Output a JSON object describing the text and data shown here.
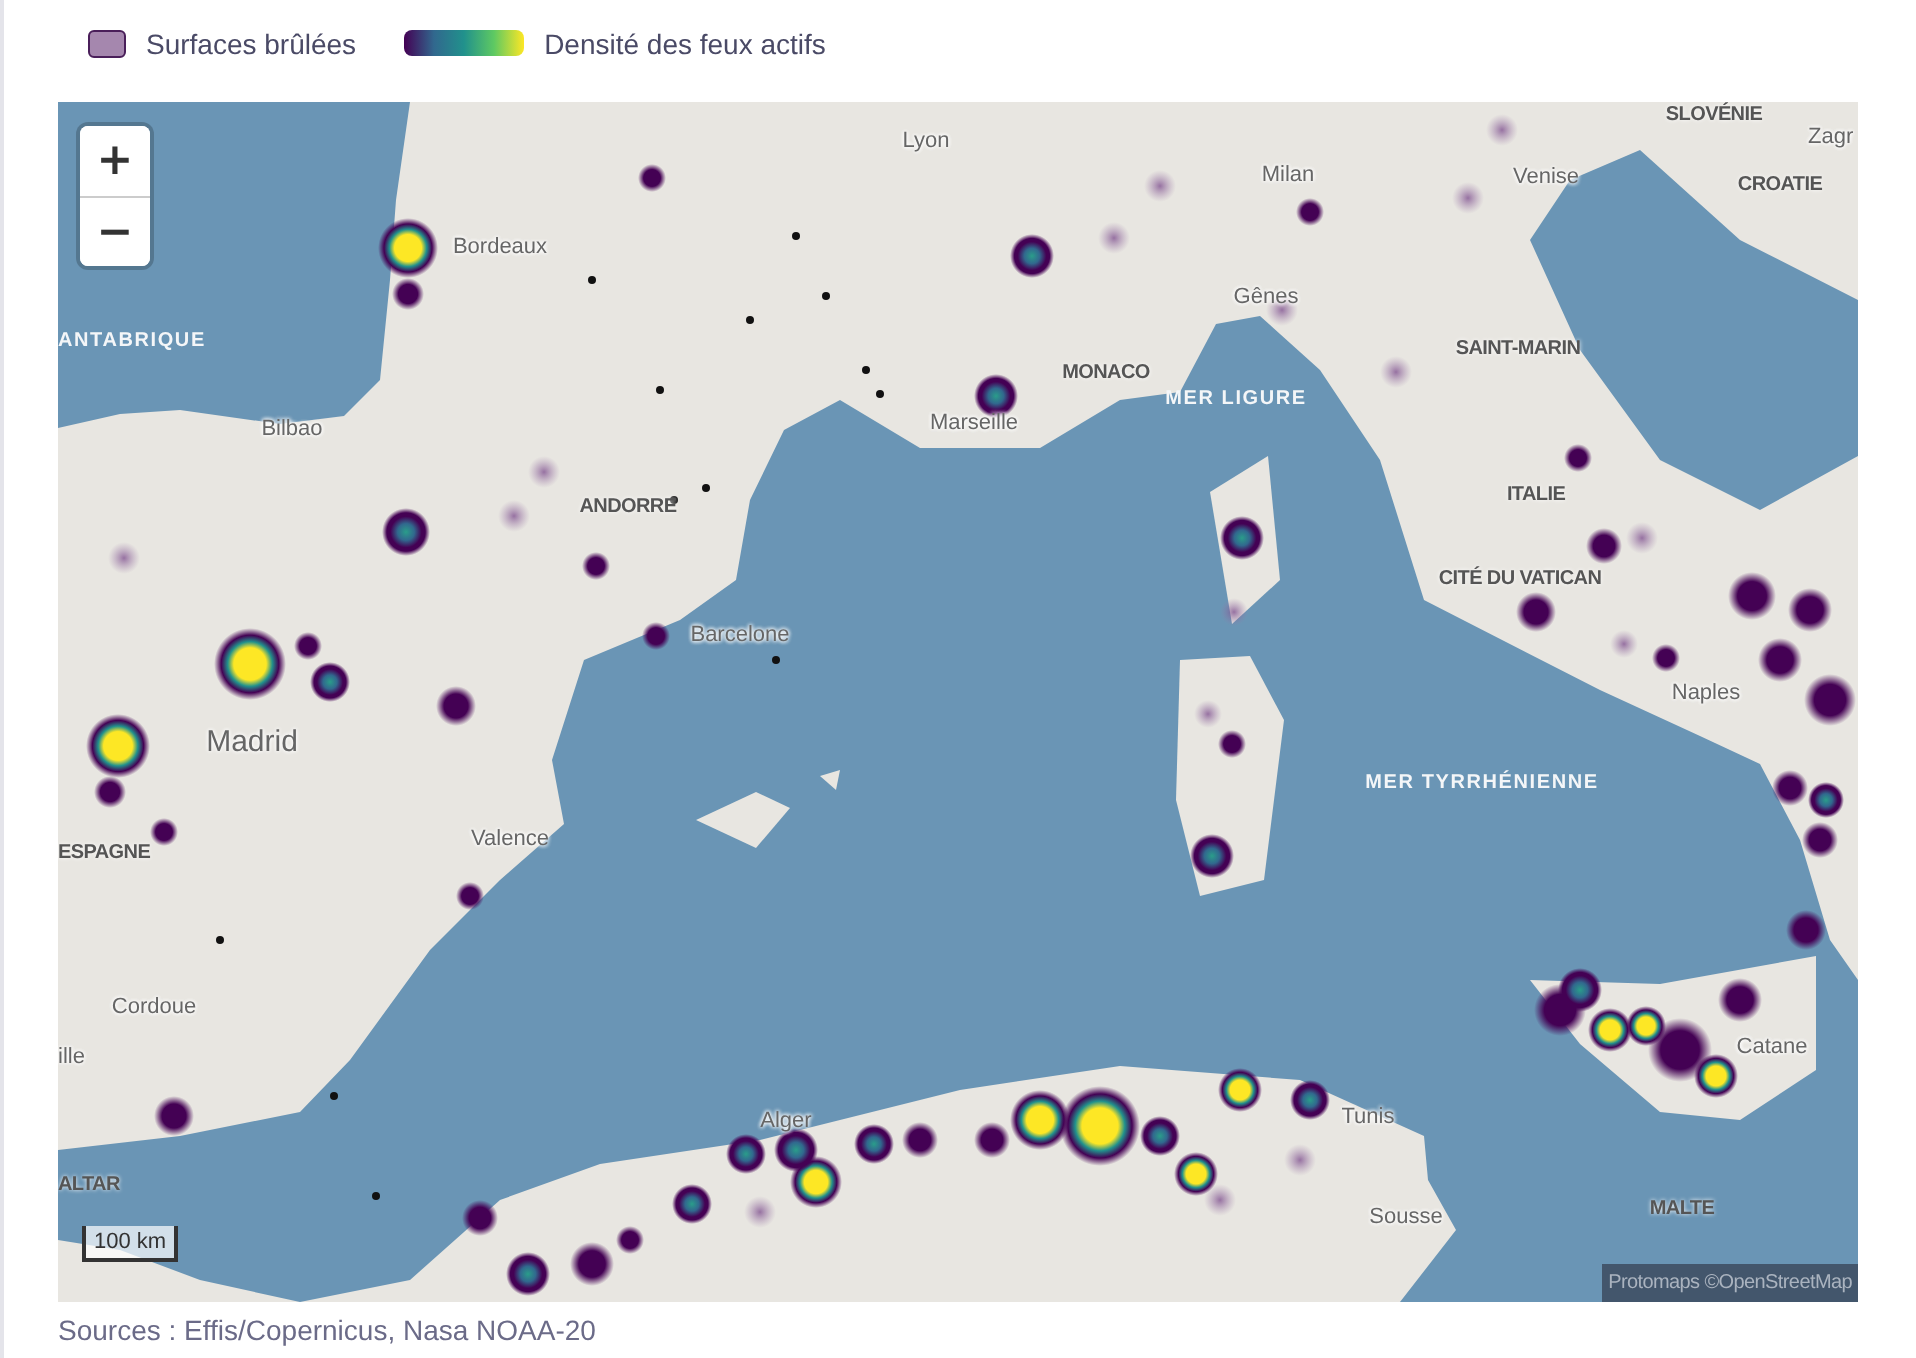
{
  "legend": [
    {
      "kind": "swatch",
      "label": "Surfaces brûlées"
    },
    {
      "kind": "gradient",
      "label": "Densité des feux actifs"
    }
  ],
  "zoom_controls": [
    "+",
    "−"
  ],
  "map": {
    "labels": [
      {
        "text": "SLOVÉNIE",
        "kind": "country"
      },
      {
        "text": "Lyon",
        "kind": "city"
      },
      {
        "text": "Zagr",
        "kind": "city"
      },
      {
        "text": "Milan",
        "kind": "city"
      },
      {
        "text": "Venise",
        "kind": "city"
      },
      {
        "text": "CROATIE",
        "kind": "country"
      },
      {
        "text": "Bordeaux",
        "kind": "city"
      },
      {
        "text": "Gênes",
        "kind": "city"
      },
      {
        "text": "ANTABRIQUE",
        "kind": "sea"
      },
      {
        "text": "SAINT-MARIN",
        "kind": "country"
      },
      {
        "text": "MONACO",
        "kind": "country"
      },
      {
        "text": "MER LIGURE",
        "kind": "sea"
      },
      {
        "text": "Marseille",
        "kind": "city"
      },
      {
        "text": "Bilbao",
        "kind": "city"
      },
      {
        "text": "ITALIE",
        "kind": "country"
      },
      {
        "text": "ANDORRE",
        "kind": "country"
      },
      {
        "text": "CITÉ DU VATICAN",
        "kind": "country"
      },
      {
        "text": "Barcelone",
        "kind": "city"
      },
      {
        "text": "Naples",
        "kind": "city"
      },
      {
        "text": "Madrid",
        "kind": "capital"
      },
      {
        "text": "MER TYRRHÉNIENNE",
        "kind": "sea"
      },
      {
        "text": "ESPAGNE",
        "kind": "country"
      },
      {
        "text": "Valence",
        "kind": "city"
      },
      {
        "text": "Cordoue",
        "kind": "city"
      },
      {
        "text": "ille",
        "kind": "city"
      },
      {
        "text": "Catane",
        "kind": "city"
      },
      {
        "text": "Alger",
        "kind": "city"
      },
      {
        "text": "ALTAR",
        "kind": "country"
      },
      {
        "text": "Tunis",
        "kind": "city"
      },
      {
        "text": "Sousse",
        "kind": "city"
      },
      {
        "text": "MALTE",
        "kind": "country"
      }
    ],
    "scale": "100 km",
    "attribution": "Protomaps ©OpenStreetMap"
  },
  "sources": "Sources : Effis/Copernicus, Nasa NOAA-20"
}
